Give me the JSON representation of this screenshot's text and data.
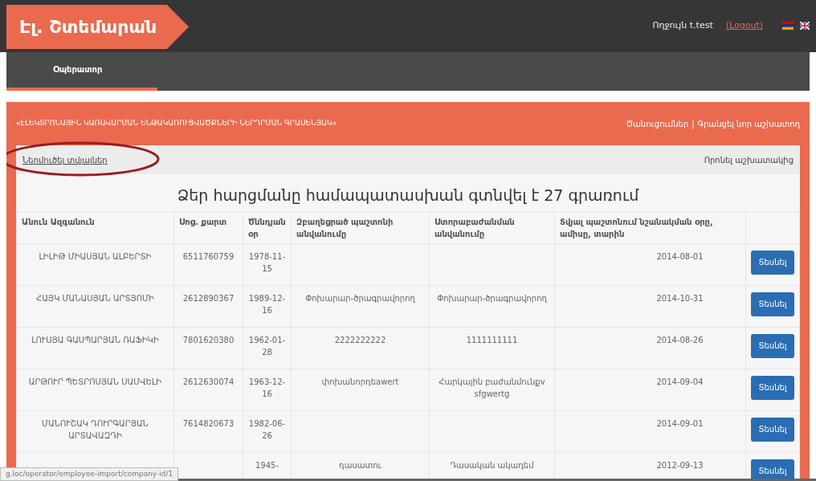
{
  "header": {
    "logo": "Էլ. Շտեմարան",
    "greeting": "Ողջույն t.test",
    "logout": "(Logout)"
  },
  "nav": [
    {
      "label": "Օպերատոր",
      "selected": true
    }
  ],
  "panel": {
    "title": "«ԷԼԵԿՏՐՈՆԱՅԻՆ ԿԱՌԱՎԱՐՄԱՆ ԵՆԹԱԿԱՌՈՒՑՎԱԾՔՆԵՐԻ ՆԵՐԴՐՄԱՆ ԳՐԱՍԵՆՅԱԿ»",
    "links": [
      "Ծանուցումներ",
      "Գրանցել նոր աշխատող"
    ],
    "separator": "|"
  },
  "toolbar": {
    "import_link": "Ներմուծել տվյալներ",
    "search_link": "Որոնել աշխատակից"
  },
  "result_heading": "Ձեր հարցմանը համապատասխան գտնվել է 27 գրառում",
  "table": {
    "columns": [
      "Անուն Ազգանուն",
      "Սոց. քարտ",
      "Ծննդյան օր",
      "Զբաղեցրած պաշտոնի անվանումը",
      "Ստորաբաժանման անվանումը",
      "Տվյալ պաշտոնում նշանակման օրը, ամիսը, տարին"
    ],
    "rows": [
      {
        "cells": [
          "ԼԻԼԻԹ ՄԻԱՍՅԱՆ ԱԼԲԵՐՏԻ",
          "6511760759",
          "1978-11-15",
          "",
          "",
          "2014-08-01"
        ],
        "button": "Տեսնել"
      },
      {
        "cells": [
          "ՀԱՅԿ ՄԱՆԱՍՅԱՆ ԱՐՏՅՈՄԻ",
          "2612890367",
          "1989-12-16",
          "Փոխարար-ծրագրավորող",
          "Փոխարար-ծրագրավորող",
          "2014-10-31"
        ],
        "button": "Տեսնել"
      },
      {
        "cells": [
          "ԼՈՒՍՅԱ ԳԱՍՊԱՐՅԱՆ ՌԱՖԻԿԻ",
          "7801620380",
          "1962-01-28",
          "2222222222",
          "1111111111",
          "2014-08-26"
        ],
        "button": "Տեսնել"
      },
      {
        "cells": [
          "ԱՐԹՈՒՐ ՊԵՏՐՈՍՅԱՆ ՍԱՄՎԵԼԻ",
          "2612630074",
          "1963-12-16",
          "փոխանորդեawert",
          "Հարկային բաժանմունքv sfgwertg",
          "2014-09-04"
        ],
        "button": "Տեսնել"
      },
      {
        "cells": [
          "ՄԱՆՈՒՇԱԿ ԴՈՒՐԳԱՐՅԱՆ ԱՐՏԱՎԱԶԴԻ",
          "7614820673",
          "1982-06-26",
          "",
          "",
          "2014-09-01"
        ],
        "button": "Տեսնել"
      },
      {
        "cells": [
          "",
          "",
          "1945-",
          "դասատու",
          "Դասական ակադեմ",
          "2012-09-13"
        ],
        "button": "Տեսնել"
      }
    ]
  },
  "status_bar": {
    "url": "g.loc/operator/employee-import/company-id/1"
  }
}
